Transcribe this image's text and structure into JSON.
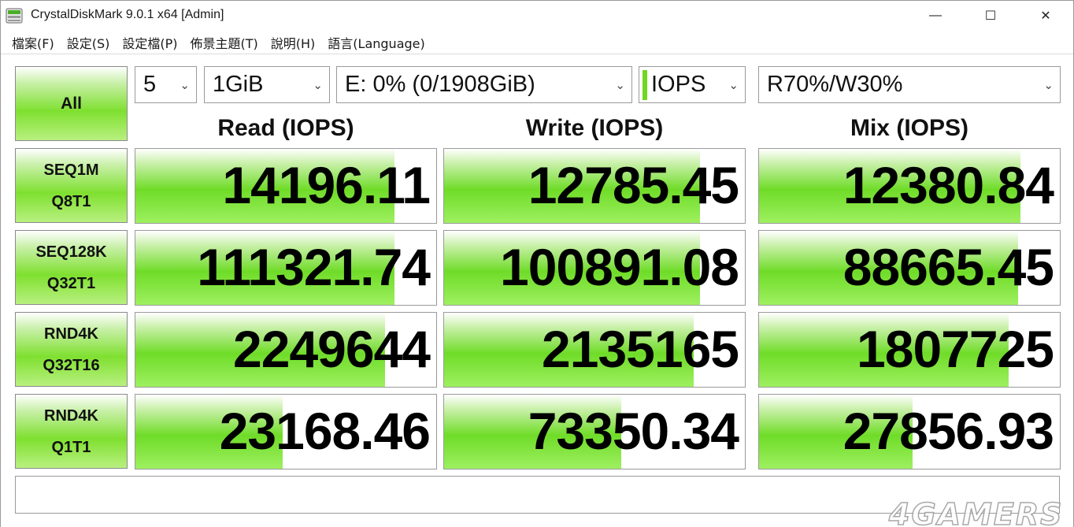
{
  "window": {
    "title": "CrystalDiskMark 9.0.1 x64 [Admin]",
    "controls": {
      "minimize": "—",
      "maximize": "☐",
      "close": "✕"
    }
  },
  "menu": [
    "檔案(F)",
    "設定(S)",
    "設定檔(P)",
    "佈景主題(T)",
    "說明(H)",
    "語言(Language)"
  ],
  "toolbar": {
    "all_label": "All",
    "count": "5",
    "size": "1GiB",
    "drive": "E: 0% (0/1908GiB)",
    "unit": "IOPS",
    "mix": "R70%/W30%"
  },
  "headers": {
    "read": "Read (IOPS)",
    "write": "Write (IOPS)",
    "mix": "Mix (IOPS)"
  },
  "rows": [
    {
      "line1": "SEQ1M",
      "line2": "Q8T1",
      "read": "14196.11",
      "write": "12785.45",
      "mix": "12380.84",
      "read_fill": 0.86,
      "write_fill": 0.85,
      "mix_fill": 0.87
    },
    {
      "line1": "SEQ128K",
      "line2": "Q32T1",
      "read": "111321.74",
      "write": "100891.08",
      "mix": "88665.45",
      "read_fill": 0.86,
      "write_fill": 0.85,
      "mix_fill": 0.86
    },
    {
      "line1": "RND4K",
      "line2": "Q32T16",
      "read": "2249644",
      "write": "2135165",
      "mix": "1807725",
      "read_fill": 0.83,
      "write_fill": 0.83,
      "mix_fill": 0.83
    },
    {
      "line1": "RND4K",
      "line2": "Q1T1",
      "read": "23168.46",
      "write": "73350.34",
      "mix": "27856.93",
      "read_fill": 0.49,
      "write_fill": 0.59,
      "mix_fill": 0.51
    }
  ],
  "status_text": "",
  "watermark": "4GAMERS",
  "colors": {
    "accent_green": "#6fdc28",
    "border": "#9a9a9a"
  }
}
